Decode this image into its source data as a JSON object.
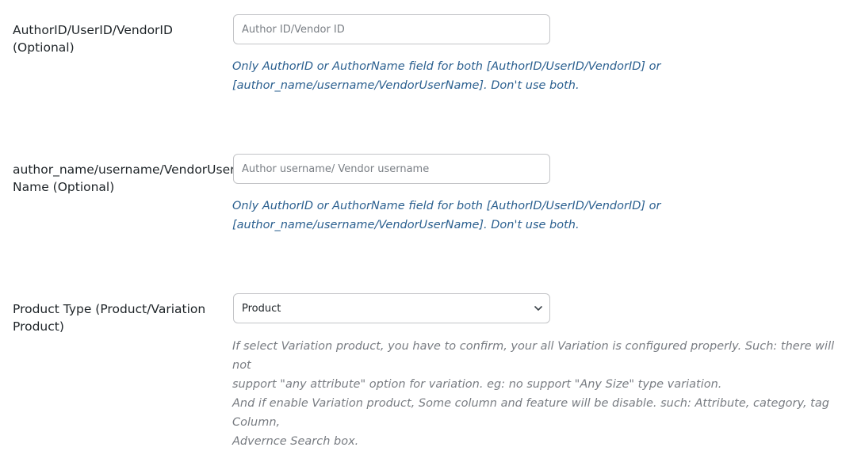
{
  "author_id": {
    "label_line1": "AuthorID/UserID/VendorID",
    "label_line2": "(Optional)",
    "placeholder": "Author ID/Vendor ID",
    "value": "",
    "help_line1": "Only AuthorID or AuthorName field for both [AuthorID/UserID/VendorID] or",
    "help_line2": "[author_name/username/VendorUserName]. Don't use both."
  },
  "author_name": {
    "label_line1": "author_name/username/VendorUser",
    "label_line2": "Name (Optional)",
    "placeholder": "Author username/ Vendor username",
    "value": "",
    "help_line1": "Only AuthorID or AuthorName field for both [AuthorID/UserID/VendorID] or",
    "help_line2": "[author_name/username/VendorUserName]. Don't use both."
  },
  "product_type": {
    "label_line1": "Product Type (Product/Variation",
    "label_line2": "Product)",
    "selected": "Product",
    "help_line1": "If select Variation product, you have to confirm, your all Variation is configured properly. Such: there will not",
    "help_line2": "support \"any attribute\" option for variation. eg: no support \"Any Size\" type variation.",
    "help_line3": "And if enable Variation product, Some column and feature will be disable. such: Attribute, category, tag Column,",
    "help_line4": "Advernce Search box."
  },
  "icons": {
    "select_chevron": "chevron-down-icon"
  },
  "colors": {
    "help_blue": "#2a5f8f",
    "help_gray": "#787c82",
    "field_border": "#c3c4c7",
    "label_text": "#1d2327"
  }
}
